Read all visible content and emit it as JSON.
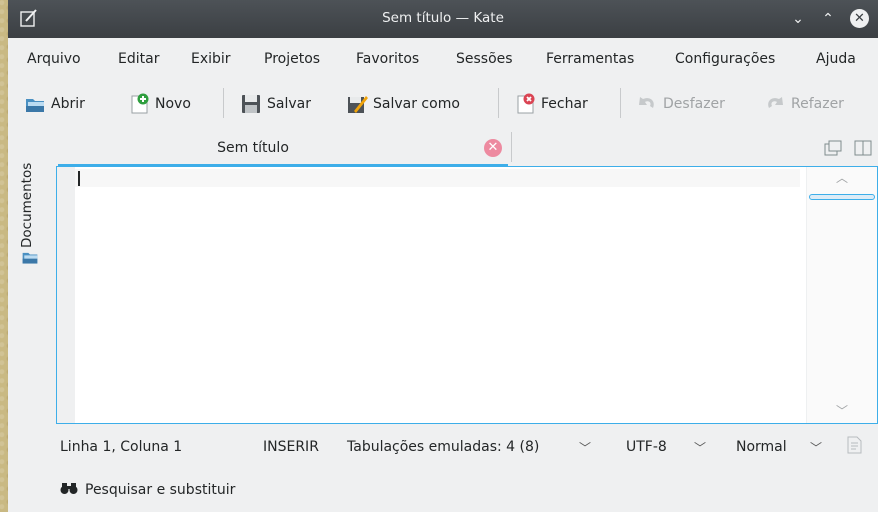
{
  "window": {
    "title": "Sem título — Kate"
  },
  "menu": [
    "Arquivo",
    "Editar",
    "Exibir",
    "Projetos",
    "Favoritos",
    "Sessões",
    "Ferramentas",
    "Configurações",
    "Ajuda"
  ],
  "toolbar": {
    "open": "Abrir",
    "new": "Novo",
    "save": "Salvar",
    "save_as": "Salvar como",
    "close": "Fechar",
    "undo": "Desfazer",
    "redo": "Refazer"
  },
  "sidebar": {
    "documents": "Documentos"
  },
  "tab": {
    "title": "Sem título"
  },
  "statusbar": {
    "position": "Linha 1, Coluna 1",
    "mode": "INSERIR",
    "indent": "Tabulações emuladas: 4 (8)",
    "encoding": "UTF-8",
    "highlight": "Normal"
  },
  "bottom": {
    "search_replace": "Pesquisar e substituir"
  },
  "colors": {
    "accent": "#3daee9",
    "titlebar": "#3b3f43",
    "window_bg": "#eff0f1",
    "tab_close": "#ed8aa0"
  }
}
